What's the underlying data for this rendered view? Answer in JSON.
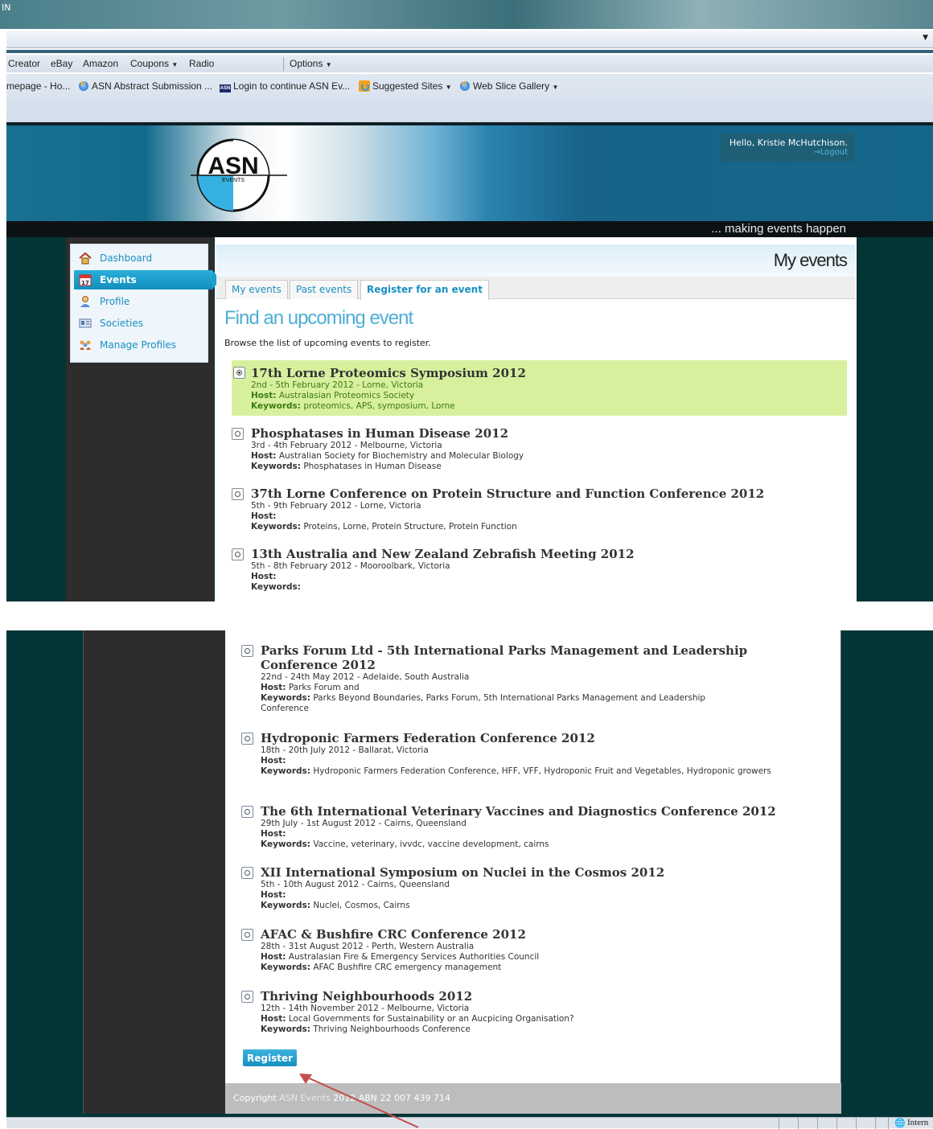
{
  "browser": {
    "title_fragment": "ІN",
    "toolbar1": {
      "items": [
        "Creator",
        "eBay",
        "Amazon",
        "Coupons",
        "Radio"
      ],
      "options": "Options"
    },
    "favorites": [
      "mepage - Ho...",
      "ASN Abstract Submission ...",
      "Login to continue  ASN Ev...",
      "Suggested Sites",
      "Web Slice Gallery"
    ],
    "status_text": "Intern"
  },
  "site": {
    "logo_text": "ASN",
    "logo_sub": "EVENTS",
    "greeting": "Hello, Kristie McHutchison.",
    "logout": "→Logout",
    "tagline": "... making events happen",
    "nav": [
      {
        "label": "Dashboard",
        "icon": "home-icon"
      },
      {
        "label": "Events",
        "icon": "calendar-icon",
        "active": true
      },
      {
        "label": "Profile",
        "icon": "person-icon"
      },
      {
        "label": "Societies",
        "icon": "id-card-icon"
      },
      {
        "label": "Manage Profiles",
        "icon": "people-icon"
      }
    ],
    "page_title": "My events",
    "tabs": [
      "My events",
      "Past events",
      "Register for an event"
    ],
    "heading": "Find an upcoming event",
    "intro": "Browse the list of upcoming events to register.",
    "host_label": "Host:",
    "keywords_label": "Keywords:",
    "events_top": [
      {
        "title": "17th Lorne Proteomics Symposium 2012",
        "date": "2nd - 5th February 2012 - Lorne, Victoria",
        "host": " Australasian Proteomics Society",
        "keywords": " proteomics, APS, symposium, Lorne",
        "selected": true
      },
      {
        "title": "Phosphatases in Human Disease 2012",
        "date": "3rd - 4th February 2012 - Melbourne, Victoria",
        "host": " Australian Society for Biochemistry and Molecular Biology",
        "keywords": " Phosphatases in Human Disease"
      },
      {
        "title": "37th Lorne Conference on Protein Structure and Function Conference 2012",
        "date": "5th - 9th February 2012 - Lorne, Victoria",
        "host": "",
        "keywords": " Proteins, Lorne, Protein Structure, Protein Function"
      },
      {
        "title": "13th Australia and New Zealand Zebrafish Meeting 2012",
        "date": "5th - 8th February 2012 - Mooroolbark, Victoria",
        "host": "",
        "keywords": ""
      }
    ],
    "events_bottom": [
      {
        "title": "Parks Forum Ltd - 5th International Parks Management and Leadership Conference 2012",
        "date": "22nd - 24th May 2012 - Adelaide, South Australia",
        "host": " Parks Forum and",
        "keywords": " Parks Beyond Boundaries, Parks Forum, 5th International Parks Management and Leadership Conference"
      },
      {
        "title": "Hydroponic Farmers Federation Conference 2012",
        "date": "18th - 20th July 2012 - Ballarat, Victoria",
        "host": "",
        "keywords": " Hydroponic Farmers Federation Conference, HFF, VFF, Hydroponic Fruit and Vegetables, Hydroponic growers"
      },
      {
        "title": "The 6th International Veterinary Vaccines and Diagnostics Conference 2012",
        "date": "29th July - 1st August 2012 - Cairns, Queensland",
        "host": "",
        "keywords": " Vaccine, veterinary, ivvdc, vaccine development, cairns"
      },
      {
        "title": "XII International Symposium on Nuclei in the Cosmos 2012",
        "date": "5th - 10th August 2012 - Cairns, Queensland",
        "host": "",
        "keywords": " Nuclei, Cosmos, Cairns"
      },
      {
        "title": "AFAC & Bushfire CRC Conference 2012",
        "date": "28th - 31st August 2012 - Perth, Western Australia",
        "host": " Australasian Fire & Emergency Services Authorities Council",
        "keywords": " AFAC Bushfire CRC emergency management"
      },
      {
        "title": "Thriving Neighbourhoods 2012",
        "date": "12th - 14th November 2012 - Melbourne, Victoria",
        "host": " Local Governments for Sustainability or an Aucpicing Organisation?",
        "keywords": " Thriving Neighbourhoods Conference"
      }
    ],
    "register_button": "Register",
    "footer": {
      "copyright": "Copyright ",
      "brand": "ASN Events",
      "rest": " 2012  ABN 22 007 439 714"
    }
  },
  "colors": {
    "accent": "#1a8fc1",
    "highlight": "#d7f09e",
    "background": "#033436",
    "annotation_arrow": "#c0504d"
  }
}
